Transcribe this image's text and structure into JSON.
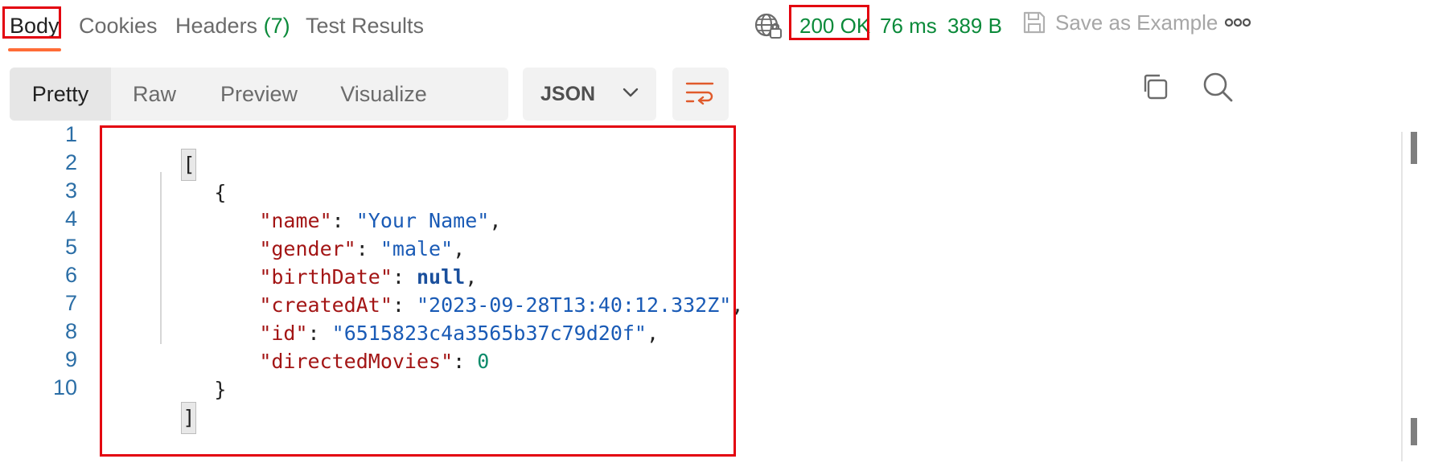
{
  "tabs": {
    "body": "Body",
    "cookies": "Cookies",
    "headers": "Headers",
    "headers_count": "(7)",
    "test_results": "Test Results"
  },
  "status": {
    "code": "200 OK",
    "time": "76 ms",
    "size": "389 B",
    "save_example": "Save as Example"
  },
  "toolbar": {
    "views": [
      "Pretty",
      "Raw",
      "Preview",
      "Visualize"
    ],
    "format": "JSON"
  },
  "code": {
    "line_numbers": [
      "1",
      "2",
      "3",
      "4",
      "5",
      "6",
      "7",
      "8",
      "9",
      "10"
    ],
    "open_bracket": "[",
    "close_bracket": "]",
    "open_brace": "{",
    "close_brace": "}",
    "fields": [
      {
        "key": "\"name\"",
        "value": "\"Your Name\"",
        "type": "string",
        "comma": ","
      },
      {
        "key": "\"gender\"",
        "value": "\"male\"",
        "type": "string",
        "comma": ","
      },
      {
        "key": "\"birthDate\"",
        "value": "null",
        "type": "keyword",
        "comma": ","
      },
      {
        "key": "\"createdAt\"",
        "value": "\"2023-09-28T13:40:12.332Z\"",
        "type": "string",
        "comma": ","
      },
      {
        "key": "\"id\"",
        "value": "\"6515823c4a3565b37c79d20f\"",
        "type": "string",
        "comma": ","
      },
      {
        "key": "\"directedMovies\"",
        "value": "0",
        "type": "number",
        "comma": ""
      }
    ]
  },
  "colors": {
    "accent": "#ff6c37",
    "success": "#0b8a3a",
    "highlight_box": "#e3000f"
  }
}
